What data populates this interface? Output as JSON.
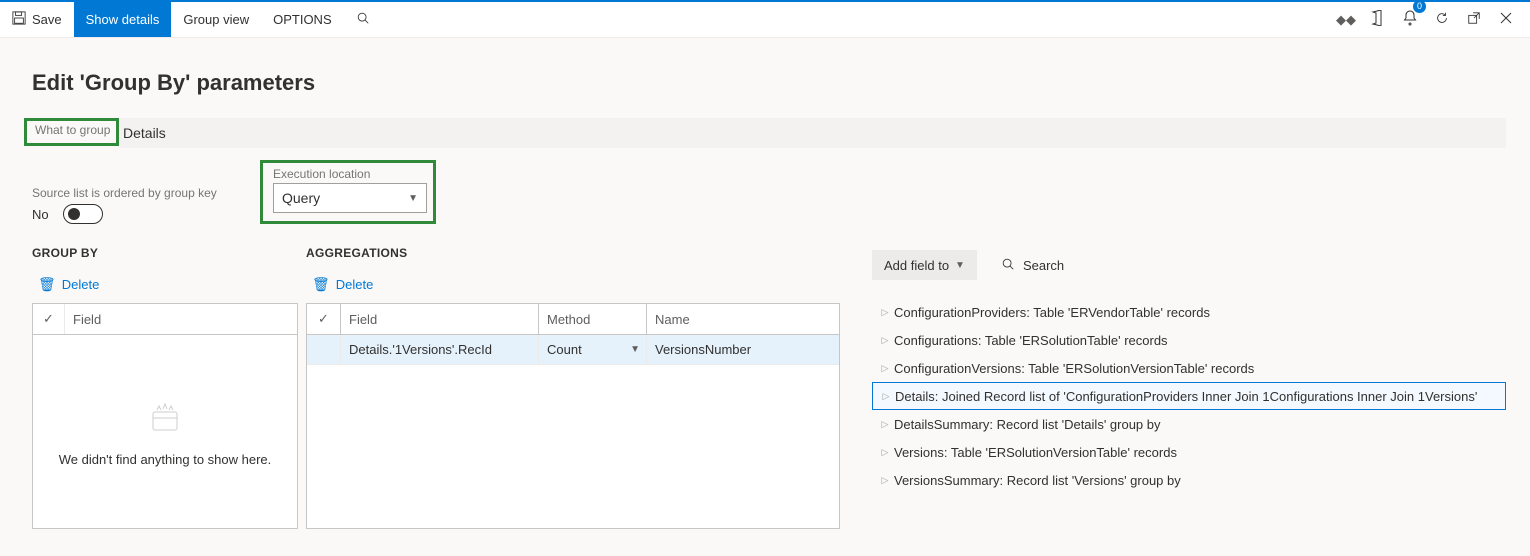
{
  "toolbar": {
    "save_label": "Save",
    "show_details_label": "Show details",
    "group_view_label": "Group view",
    "options_label": "OPTIONS",
    "notif_count": "0"
  },
  "page": {
    "title": "Edit 'Group By' parameters"
  },
  "params": {
    "what_label": "What to group",
    "what_value": "Details",
    "ordered_label": "Source list is ordered by group key",
    "ordered_value": "No",
    "exec_label": "Execution location",
    "exec_value": "Query"
  },
  "group_by": {
    "heading": "GROUP BY",
    "delete": "Delete",
    "field_col": "Field",
    "empty_text": "We didn't find anything to show here."
  },
  "aggregations": {
    "heading": "AGGREGATIONS",
    "delete": "Delete",
    "cols": {
      "field": "Field",
      "method": "Method",
      "name": "Name"
    },
    "rows": [
      {
        "field": "Details.'1Versions'.RecId",
        "method": "Count",
        "name": "VersionsNumber"
      }
    ]
  },
  "right": {
    "add_field": "Add field to",
    "search": "Search",
    "tree": [
      {
        "label": "ConfigurationProviders: Table 'ERVendorTable' records",
        "sel": false
      },
      {
        "label": "Configurations: Table 'ERSolutionTable' records",
        "sel": false
      },
      {
        "label": "ConfigurationVersions: Table 'ERSolutionVersionTable' records",
        "sel": false
      },
      {
        "label": "Details: Joined Record list of 'ConfigurationProviders Inner Join 1Configurations Inner Join 1Versions'",
        "sel": true
      },
      {
        "label": "DetailsSummary: Record list 'Details' group by",
        "sel": false
      },
      {
        "label": "Versions: Table 'ERSolutionVersionTable' records",
        "sel": false
      },
      {
        "label": "VersionsSummary: Record list 'Versions' group by",
        "sel": false
      }
    ]
  }
}
